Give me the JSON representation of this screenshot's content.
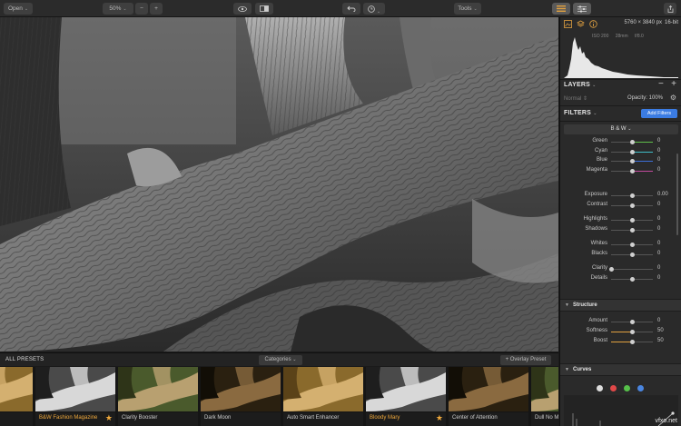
{
  "toolbar": {
    "open_label": "Open",
    "zoom_value": "50%",
    "zoom_out": "−",
    "zoom_in": "+",
    "tools_label": "Tools"
  },
  "presets": {
    "title": "ALL PRESETS",
    "categories_label": "Categories",
    "overlay_label": "+ Overlay Preset",
    "items": [
      {
        "name": "rong",
        "selected": false,
        "star": false,
        "tone": "warm"
      },
      {
        "name": "B&W Fashion Magazine",
        "selected": true,
        "star": true,
        "tone": "bw"
      },
      {
        "name": "Clarity Booster",
        "selected": false,
        "star": false,
        "tone": "natural"
      },
      {
        "name": "Dark Moon",
        "selected": false,
        "star": false,
        "tone": "dark"
      },
      {
        "name": "Auto Smart Enhancer",
        "selected": false,
        "star": false,
        "tone": "warm"
      },
      {
        "name": "Bloody Mary",
        "selected": true,
        "star": true,
        "tone": "bw"
      },
      {
        "name": "Center of Attention",
        "selected": false,
        "star": false,
        "tone": "dark"
      },
      {
        "name": "Dull No M",
        "selected": false,
        "star": false,
        "tone": "natural"
      }
    ]
  },
  "panel": {
    "dimensions": "5760 × 3840 px",
    "bit_depth": "16-bit",
    "exif": [
      "ISO 200",
      "28mm",
      "f/8.0"
    ],
    "layers_title": "LAYERS",
    "blend_mode": "Normal",
    "opacity_label": "Opacity: 100%",
    "filters_title": "FILTERS",
    "add_filters": "Add Filters",
    "filter_name": "B & W",
    "color_sliders": [
      {
        "label": "Green",
        "value": "0",
        "fill": 0.5,
        "color": "#5fbf4a"
      },
      {
        "label": "Cyan",
        "value": "0",
        "fill": 0.5,
        "color": "#3fbcc6"
      },
      {
        "label": "Blue",
        "value": "0",
        "fill": 0.5,
        "color": "#3d6fd8"
      },
      {
        "label": "Magenta",
        "value": "0",
        "fill": 0.5,
        "color": "#c14a9c"
      }
    ],
    "tone_sliders": [
      {
        "label": "Exposure",
        "value": "0.00",
        "fill": 0.5
      },
      {
        "label": "Contrast",
        "value": "0",
        "fill": 0.5
      },
      {
        "label": "Highlights",
        "value": "0",
        "fill": 0.5
      },
      {
        "label": "Shadows",
        "value": "0",
        "fill": 0.5
      },
      {
        "label": "Whites",
        "value": "0",
        "fill": 0.5
      },
      {
        "label": "Blacks",
        "value": "0",
        "fill": 0.5
      },
      {
        "label": "Clarity",
        "value": "0",
        "fill": 0.0
      },
      {
        "label": "Details",
        "value": "0",
        "fill": 0.5
      }
    ],
    "structure_title": "Structure",
    "structure_sliders": [
      {
        "label": "Amount",
        "value": "0",
        "fill": 0.5
      },
      {
        "label": "Softness",
        "value": "50",
        "fill": 0.5,
        "accent": true
      },
      {
        "label": "Boost",
        "value": "50",
        "fill": 0.5,
        "accent": true
      }
    ],
    "curves_title": "Curves",
    "curve_channels": [
      {
        "name": "rgb",
        "color": "#dddddd"
      },
      {
        "name": "red",
        "color": "#e04848"
      },
      {
        "name": "green",
        "color": "#56c04a"
      },
      {
        "name": "blue",
        "color": "#4a86e0"
      }
    ],
    "watermark": "vfxo.net"
  },
  "colors": {
    "accent_blue": "#3b7ce3",
    "preset_selected": "#f0a93c"
  }
}
